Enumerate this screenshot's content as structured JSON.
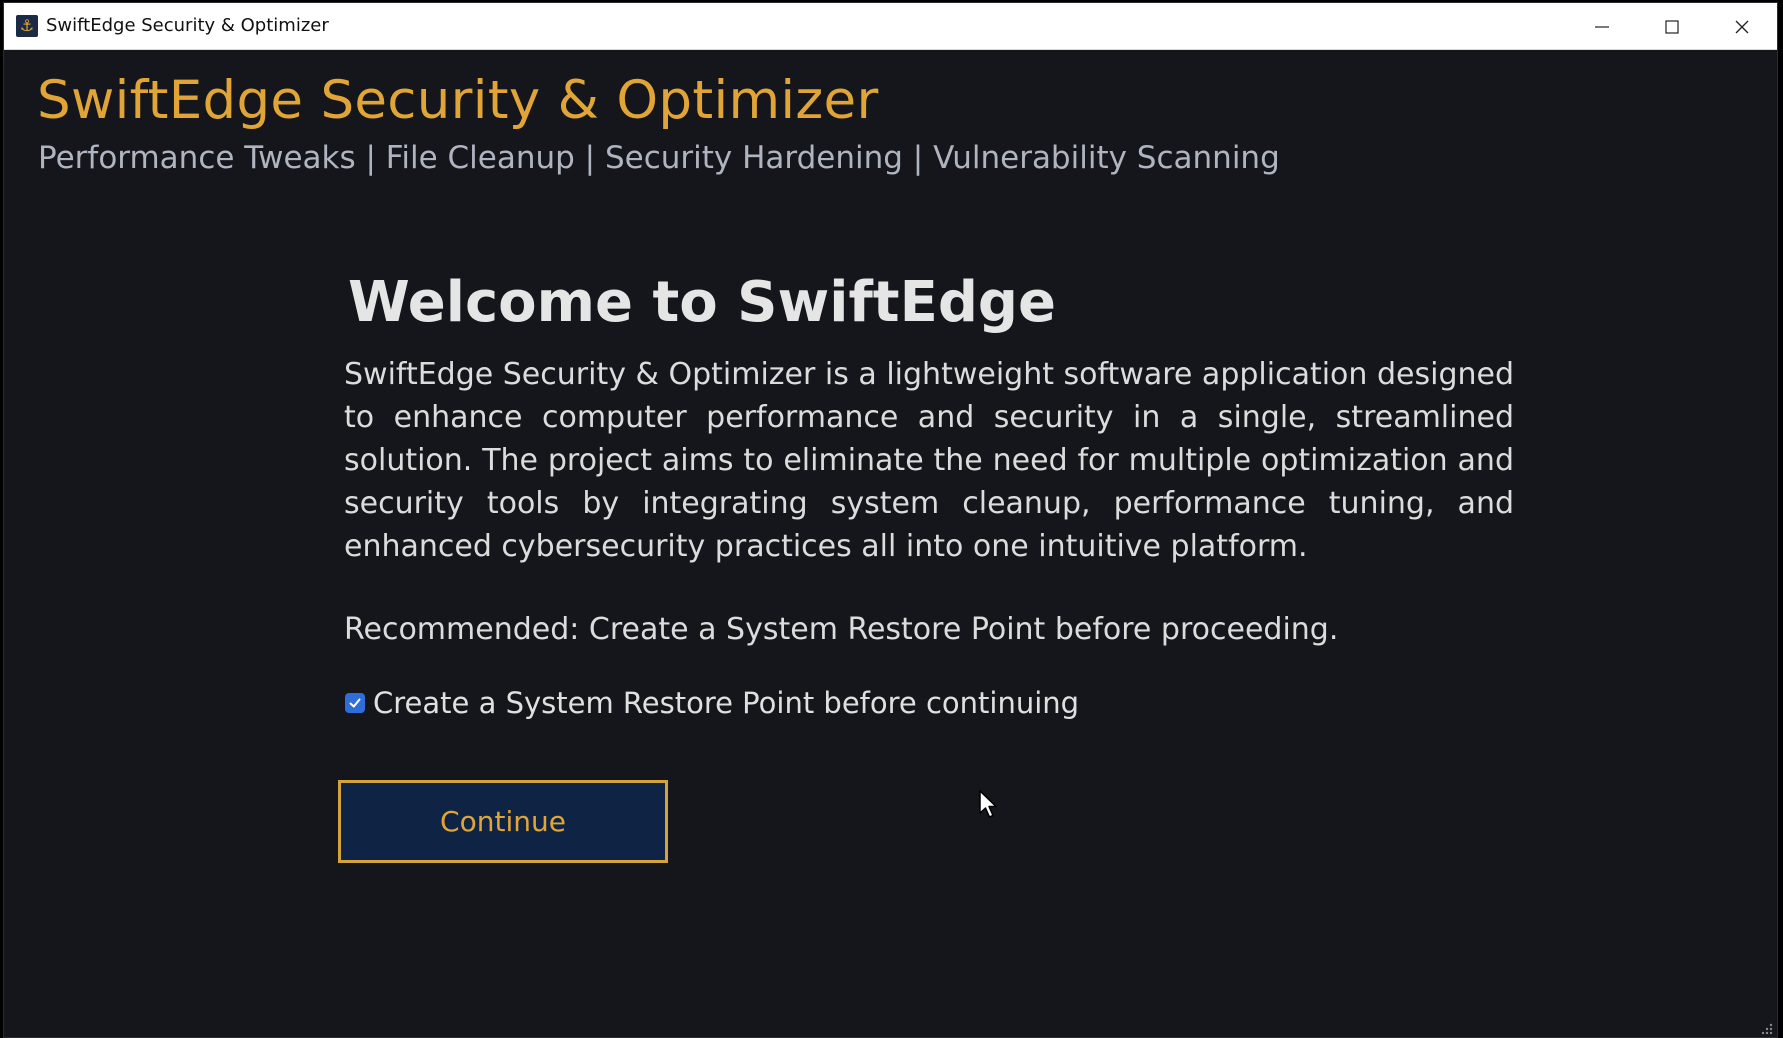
{
  "window": {
    "title": "SwiftEdge Security & Optimizer",
    "icon": "app-icon"
  },
  "header": {
    "app_title": "SwiftEdge Security & Optimizer",
    "subtitle": "Performance Tweaks | File Cleanup | Security Hardening | Vulnerability Scanning"
  },
  "main": {
    "heading": "Welcome to SwiftEdge",
    "description": "SwiftEdge Security & Optimizer is a lightweight software application designed to enhance computer performance and security in a single, streamlined solution. The project aims to eliminate the need for multiple optimization and security tools by integrating system cleanup, performance tuning, and enhanced cybersecurity practices all into one intuitive platform.",
    "recommendation": "Recommended: Create a System Restore Point before proceeding.",
    "restore_checkbox": {
      "label": "Create a System Restore Point before continuing",
      "checked": true
    },
    "continue_label": "Continue"
  },
  "colors": {
    "background": "#14161b",
    "accent_gold": "#e0a536",
    "button_bg": "#0f2345",
    "checkbox_blue": "#2f6ed8"
  }
}
